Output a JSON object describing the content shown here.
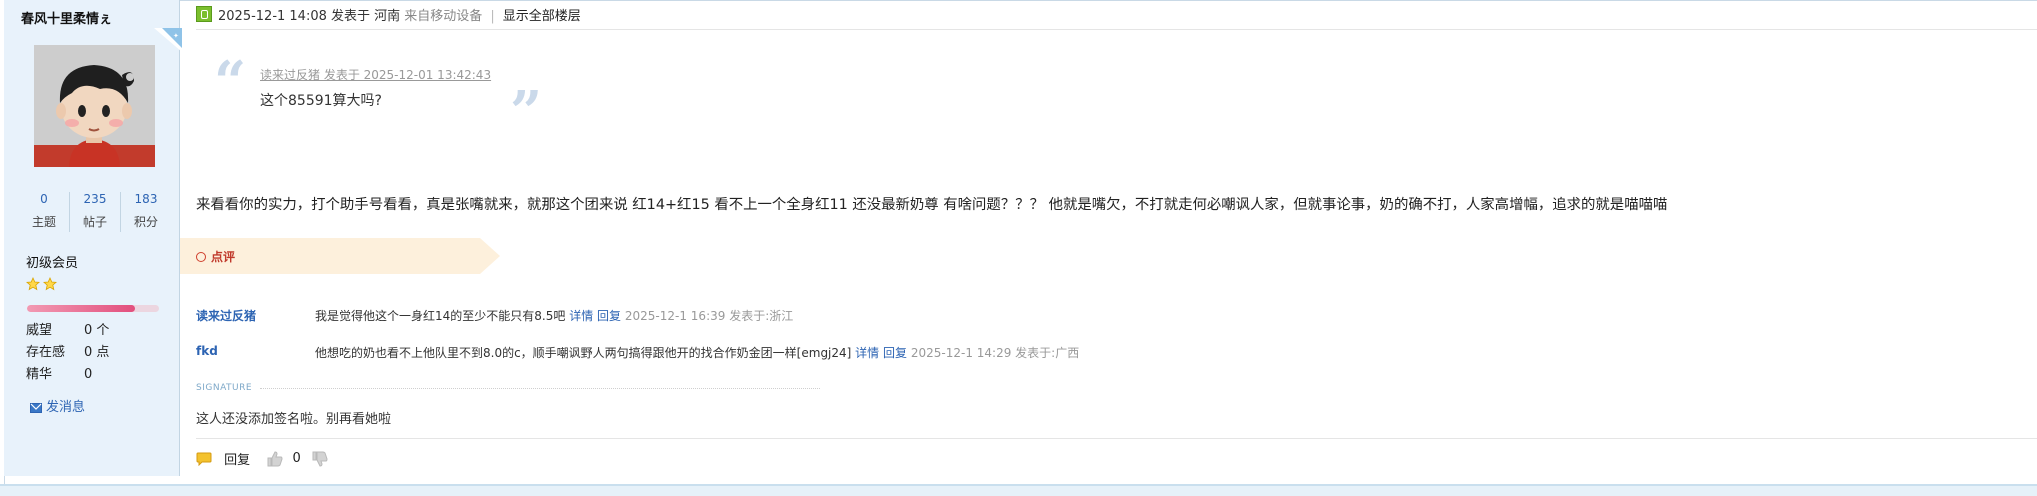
{
  "author": {
    "username": "春风十里柔情ぇ",
    "stats": [
      {
        "value": "0",
        "label": "主题"
      },
      {
        "value": "235",
        "label": "帖子"
      },
      {
        "value": "183",
        "label": "积分"
      }
    ],
    "rank": "初级会员",
    "star_count": 2,
    "level_progress": 0.82,
    "info": [
      {
        "key": "威望",
        "value": "0 个"
      },
      {
        "key": "存在感",
        "value": "0 点"
      },
      {
        "key": "精华",
        "value": "0"
      }
    ],
    "send_message_label": "发消息"
  },
  "post": {
    "datetime": "2025-12-1 14:08",
    "posted_in": "发表于 河南",
    "device": "来自移动设备",
    "show_all_floors": "显示全部楼层",
    "quote": {
      "meta": "读来过反猪 发表于 2025-12-01 13:42:43",
      "text": "这个85591算大吗?"
    },
    "body": "来看看你的实力，打个助手号看看，真是张嘴就来，就那这个团来说  红14+红15  看不上一个全身红11  还没最新奶尊  有啥问题？？？ 他就是嘴欠，不打就走何必嘲讽人家，但就事论事，奶的确不打，人家高增幅，追求的就是喵喵喵"
  },
  "comments_section": {
    "tab_label": "点评",
    "items": [
      {
        "user": "读来过反猪",
        "text": "我是觉得他这个一身红14的至少不能只有8.5吧",
        "detail_label": "详情",
        "reply_label": "回复",
        "meta": "2025-12-1 16:39 发表于:浙江"
      },
      {
        "user": "fkd",
        "text": "他想吃的奶也看不上他队里不到8.0的c，顺手嘲讽野人两句搞得跟他开的找合作奶金团一样[emgj24]",
        "detail_label": "详情",
        "reply_label": "回复",
        "meta": "2025-12-1 14:29 发表于:广西"
      }
    ]
  },
  "signature": {
    "label": "SIGNATURE",
    "text": "这人还没添加签名啦。别再看她啦"
  },
  "actions": {
    "reply_label": "回复",
    "like_count": "0"
  },
  "colors": {
    "link_blue": "#2d64b3",
    "sidebar_bg": "#e8f2fb",
    "comment_tab_bg": "#fdf0dc",
    "comment_red": "#c0392b",
    "quote_mark": "#cad9ea",
    "progress_pink": "#e24f7d"
  }
}
